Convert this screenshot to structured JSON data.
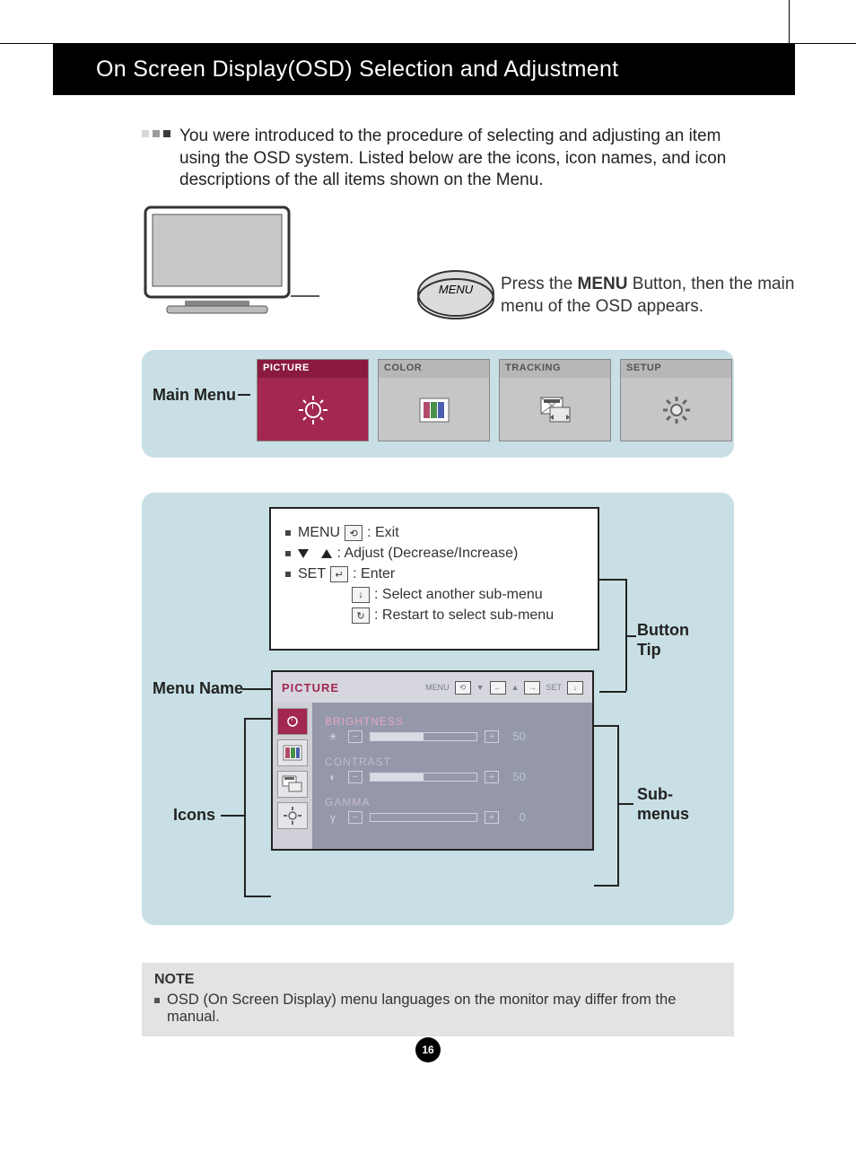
{
  "header": {
    "title": "On Screen Display(OSD) Selection and Adjustment"
  },
  "intro": {
    "text": "You were introduced to the procedure of selecting and adjusting an item using the OSD system. Listed below are the icons, icon names, and icon descriptions of the all items shown on the Menu."
  },
  "menu_button": {
    "label": "MENU"
  },
  "press": {
    "before": "Press the ",
    "bold": "MENU",
    "after": " Button, then the main menu of the OSD appears."
  },
  "labels": {
    "main_menu": "Main Menu",
    "menu_name": "Menu Name",
    "icons": "Icons",
    "button_tip_1": "Button",
    "button_tip_2": "Tip",
    "sub_menus_1": "Sub-",
    "sub_menus_2": "menus"
  },
  "tabs": [
    {
      "name": "PICTURE",
      "active": true,
      "icon": "brightness-icon"
    },
    {
      "name": "COLOR",
      "active": false,
      "icon": "color-bars-icon"
    },
    {
      "name": "TRACKING",
      "active": false,
      "icon": "tracking-icon"
    },
    {
      "name": "SETUP",
      "active": false,
      "icon": "gear-icon"
    }
  ],
  "button_tips": {
    "menu_label": "MENU",
    "menu_desc": ": Exit",
    "adjust_desc": ": Adjust (Decrease/Increase)",
    "set_label": "SET",
    "set_desc": ": Enter",
    "select_desc": ": Select another sub-menu",
    "restart_desc": ": Restart to select sub-menu"
  },
  "osd": {
    "title": "PICTURE",
    "topbar_menu": "MENU",
    "topbar_set": "SET",
    "side_icons": [
      "brightness-icon",
      "color-bars-icon",
      "tracking-icon",
      "gear-icon"
    ],
    "items": [
      {
        "name": "BRIGHTNESS",
        "value": 50,
        "fill": 50,
        "glyph": "☀",
        "active": true
      },
      {
        "name": "CONTRAST",
        "value": 50,
        "fill": 50,
        "glyph": "◐",
        "active": false
      },
      {
        "name": "GAMMA",
        "value": 0,
        "fill": 0,
        "glyph": "γ",
        "active": false
      }
    ]
  },
  "note": {
    "heading": "NOTE",
    "text": "OSD (On Screen Display) menu languages on the monitor may differ from the manual."
  },
  "page_number": "16"
}
